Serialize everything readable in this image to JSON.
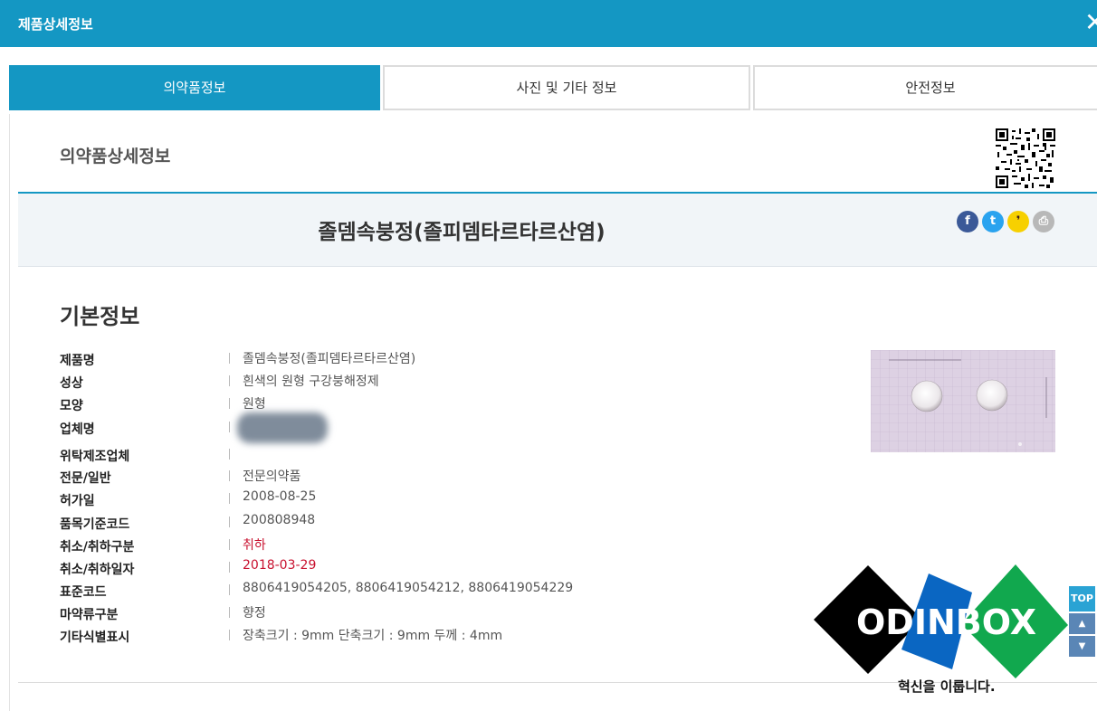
{
  "window": {
    "title": "제품상세정보",
    "close_icon": "close-icon"
  },
  "tabs": [
    {
      "label": "의약품정보",
      "active": true
    },
    {
      "label": "사진 및 기타 정보",
      "active": false
    },
    {
      "label": "안전정보",
      "active": false
    }
  ],
  "detail": {
    "section_title": "의약품상세정보",
    "product_name": "졸뎀속붕정(졸피뎀타르타르산염)",
    "share_icons": [
      "facebook-icon",
      "twitter-icon",
      "kakaostory-icon",
      "print-icon"
    ]
  },
  "basic_info": {
    "title": "기본정보",
    "rows": [
      {
        "label": "제품명",
        "value": "졸뎀속붕정(졸피뎀타르타르산염)"
      },
      {
        "label": "성상",
        "value": "흰색의 원형 구강붕해정제"
      },
      {
        "label": "모양",
        "value": "원형"
      },
      {
        "label": "업체명",
        "value": ""
      },
      {
        "label": "위탁제조업체",
        "value": ""
      },
      {
        "label": "전문/일반",
        "value": "전문의약품"
      },
      {
        "label": "허가일",
        "value": "2008-08-25"
      },
      {
        "label": "품목기준코드",
        "value": "200808948"
      },
      {
        "label": "취소/취하구분",
        "value": "취하"
      },
      {
        "label": "취소/취하일자",
        "value": "2018-03-29"
      },
      {
        "label": "표준코드",
        "value": "8806419054205, 8806419054212, 8806419054229"
      },
      {
        "label": "마약류구분",
        "value": "향정"
      },
      {
        "label": "기타식별표시",
        "value": "장축크기 : 9mm 단축크기 : 9mm 두께 : 4mm"
      }
    ]
  },
  "watermark": {
    "brand": "ODINBOX",
    "tagline": "혁신을 이룹니다."
  },
  "scroll": {
    "top_label": "TOP"
  },
  "colors": {
    "accent": "#1497c3",
    "cancel_red": "#c8102e",
    "logo_black": "#000000",
    "logo_blue": "#0a66c2",
    "logo_green": "#11a84e"
  }
}
